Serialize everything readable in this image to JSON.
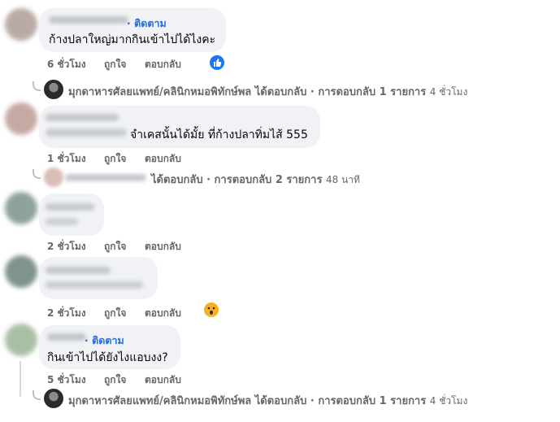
{
  "comments": [
    {
      "follow_label": "· ติดตาม",
      "text": "ก้างปลาใหญ่มากกินเข้าไปได้ไงคะ",
      "time": "6 ชั่วโมง",
      "like": "ถูกใจ",
      "reply": "ตอบกลับ",
      "reaction_icon": "like-reaction",
      "reply_summary": {
        "text": "มุกดาหารศัลยแพทย์/คลินิกหมอพิทักษ์พล ได้ตอบกลับ · การตอบกลับ 1 รายการ",
        "ago": "4 ชั่วโมง"
      }
    },
    {
      "text": "จำเคสนั้นได้มั้ย ที่ก้างปลาทิ่มไส้ 555",
      "time": "1 ชั่วโมง",
      "like": "ถูกใจ",
      "reply": "ตอบกลับ",
      "reply_summary": {
        "text": "ได้ตอบกลับ · การตอบกลับ 2 รายการ",
        "ago": "48 นาที"
      }
    },
    {
      "time": "2 ชั่วโมง",
      "like": "ถูกใจ",
      "reply": "ตอบกลับ"
    },
    {
      "time": "2 ชั่วโมง",
      "like": "ถูกใจ",
      "reply": "ตอบกลับ",
      "reaction_icon": "wow-reaction"
    },
    {
      "follow_label": "· ติดตาม",
      "text": "กินเข้าไปได้ยังไงแอบงง?",
      "time": "5 ชั่วโมง",
      "like": "ถูกใจ",
      "reply": "ตอบกลับ",
      "reply_summary": {
        "text": "มุกดาหารศัลยแพทย์/คลินิกหมอพิทักษ์พล ได้ตอบกลับ · การตอบกลับ 1 รายการ",
        "ago": "4 ชั่วโมง"
      }
    }
  ],
  "colors": {
    "bubble": "#f0f2f5",
    "meta": "#65676b",
    "link": "#216fdb",
    "like": "#1877f2",
    "wow": "#f7b125"
  }
}
